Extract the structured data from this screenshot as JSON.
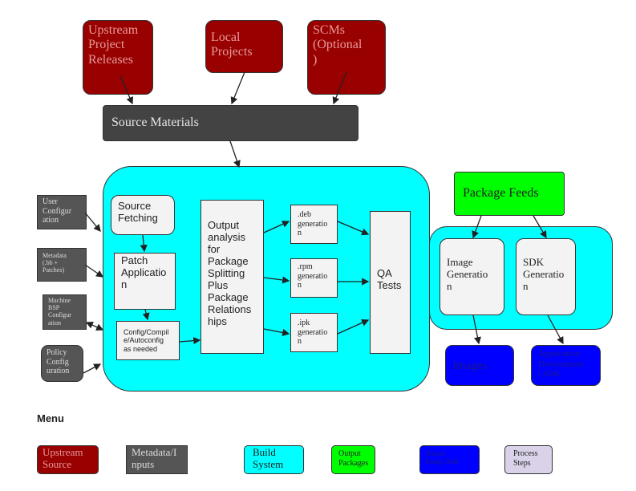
{
  "nodes": {
    "upstream": "Upstream\nProject\nReleases",
    "local": "Local\nProjects",
    "scms": "SCMs\n(Optional\n)",
    "source_materials": "Source Materials",
    "source_fetching": "Source\nFetching",
    "patch": "Patch\nApplicatio\nn",
    "config": "Config/Compil\ne/Autoconfig\nas needed",
    "output_analysis": "Output\nanalysis\nfor\nPackage\nSplitting\nPlus\nPackage\nRelations\nhips",
    "deb": ".deb\ngeneratio\nn",
    "rpm": ".rpm\ngeneratio\nn",
    "ipk": ".ipk\ngeneratio\nn",
    "qa": "QA\nTests",
    "package_feeds": "Package Feeds",
    "image_gen": "Image\nGeneratio\nn",
    "sdk_gen": "SDK\nGeneratio\nn",
    "images": "Images",
    "app_sdk": "Application\nDevelopmen\nt SDK",
    "user_config": "User\nConfigur\nation",
    "metadata": "Metadata\n(.bb +\nPatches)",
    "machine": "Machine\nBSP\nConfigur\nation",
    "policy": "Policy\nConfig\nuration"
  },
  "legend": {
    "title": "Menu",
    "items": [
      {
        "label": "Upstream\nSource",
        "color": "#990000"
      },
      {
        "label": "Metadata/I\nnputs",
        "color": "#555555"
      },
      {
        "label": "Build\nSystem",
        "color": "#00ffff"
      },
      {
        "label": "Output\nPackages",
        "color": "#00ff00"
      },
      {
        "label": "Output\nImage Data",
        "color": "#0000ff"
      },
      {
        "label": "Process\nSteps",
        "color": "#d9d2e9"
      }
    ]
  }
}
